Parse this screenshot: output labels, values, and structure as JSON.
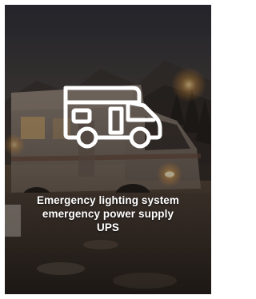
{
  "card": {
    "icon": "motorhome-icon",
    "caption_lines": [
      "Emergency lighting system",
      "emergency power supply",
      "UPS"
    ]
  },
  "colors": {
    "icon_stroke": "#ffffff",
    "caption_text": "#ffffff",
    "lamp_glow": "#ffd27a"
  }
}
